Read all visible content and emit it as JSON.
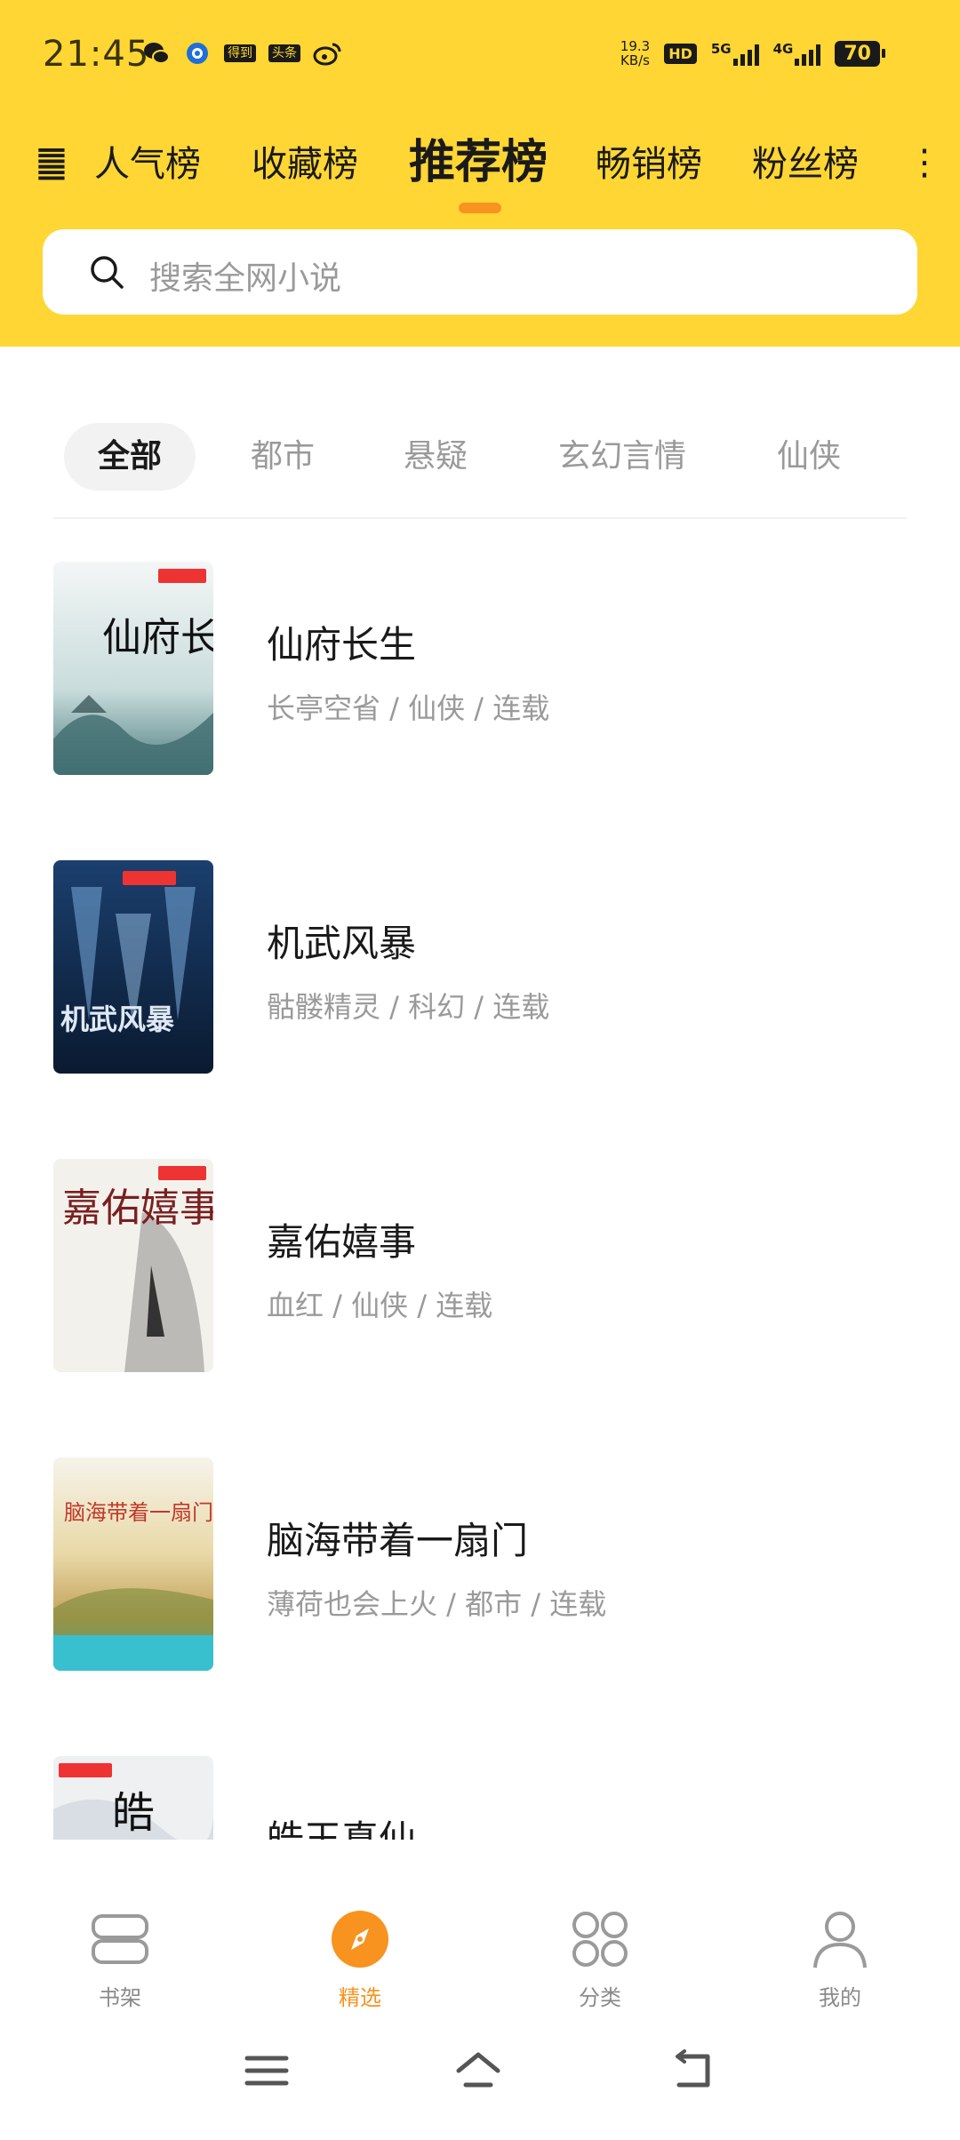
{
  "status_bar": {
    "time": "21:45",
    "net_speed_value": "19.3",
    "net_speed_unit": "KB/s",
    "hd_label": "HD",
    "sig1_label": "5G",
    "sig2_label": "4G",
    "battery": "70",
    "app_icons": [
      "wechat-icon",
      "browser-icon",
      "dedao-icon",
      "toutiao-icon",
      "weibo-icon"
    ],
    "dedao_text": "得到",
    "toutiao_text": "头条"
  },
  "rank_tabs": {
    "items": [
      "人气榜",
      "收藏榜",
      "推荐榜",
      "畅销榜",
      "粉丝榜"
    ],
    "active_index": 2
  },
  "search": {
    "placeholder": "搜索全网小说"
  },
  "categories": {
    "items": [
      "全部",
      "都市",
      "悬疑",
      "玄幻言情",
      "仙侠"
    ],
    "active_index": 0
  },
  "books": [
    {
      "title": "仙府长生",
      "meta": "长亭空省 / 仙侠 / 连载",
      "cover_text": "仙府长生"
    },
    {
      "title": "机武风暴",
      "meta": "骷髅精灵 / 科幻 / 连载",
      "cover_text": "机武风暴"
    },
    {
      "title": "嘉佑嬉事",
      "meta": "血红 / 仙侠 / 连载",
      "cover_text": "嘉佑嬉事"
    },
    {
      "title": "脑海带着一扇门",
      "meta": "薄荷也会上火 / 都市 / 连载",
      "cover_text": "脑海带着一扇门"
    },
    {
      "title": "皓玉真仙",
      "meta": "",
      "cover_text": "皓"
    }
  ],
  "bottom_nav": {
    "items": [
      {
        "label": "书架",
        "icon": "bookshelf-icon"
      },
      {
        "label": "精选",
        "icon": "compass-icon"
      },
      {
        "label": "分类",
        "icon": "category-icon"
      },
      {
        "label": "我的",
        "icon": "profile-icon"
      }
    ],
    "active_index": 1
  },
  "colors": {
    "header": "#FFD633",
    "accent": "#F7931E",
    "muted_text": "#9a9a9a"
  }
}
